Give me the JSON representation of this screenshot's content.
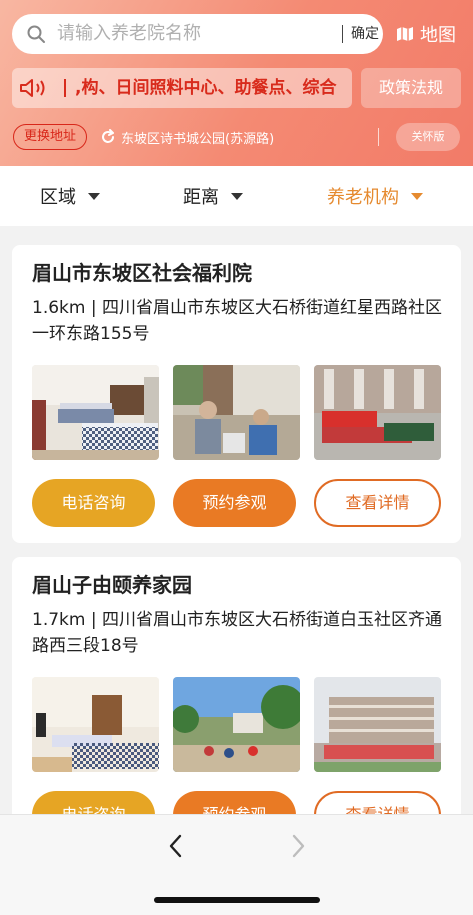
{
  "search": {
    "placeholder": "请输入养老院名称",
    "confirm_label": "确定"
  },
  "map_label": "地图",
  "notice": {
    "text": ",构、日间照料中心、助餐点、综合"
  },
  "policy_label": "政策法规",
  "change_address_label": "更换地址",
  "location_text": "东坡区诗书城公园(苏源路)",
  "care_mode_label": "关怀版",
  "filters": [
    {
      "label": "区域"
    },
    {
      "label": "距离"
    },
    {
      "label": "养老机构",
      "active": true
    }
  ],
  "facilities": [
    {
      "name": "眉山市东坡区社会福利院",
      "distance_address": "1.6km | 四川省眉山市东坡区大石桥街道红星西路社区一环东路155号",
      "photos": [
        "bedroom-photo",
        "activity-photo",
        "group-photo"
      ]
    },
    {
      "name": "眉山子由颐养家园",
      "distance_address": "1.7km | 四川省眉山市东坡区大石桥街道白玉社区齐通路西三段18号",
      "photos": [
        "bedroom-photo",
        "courtyard-photo",
        "building-photo"
      ]
    }
  ],
  "buttons": {
    "phone": "电话咨询",
    "visit": "预约参观",
    "detail": "查看详情"
  },
  "colors": {
    "accent_orange": "#e97a24",
    "accent_gold": "#e6a524",
    "notice_red": "#d82b1c",
    "filter_active": "#e58a2f"
  }
}
